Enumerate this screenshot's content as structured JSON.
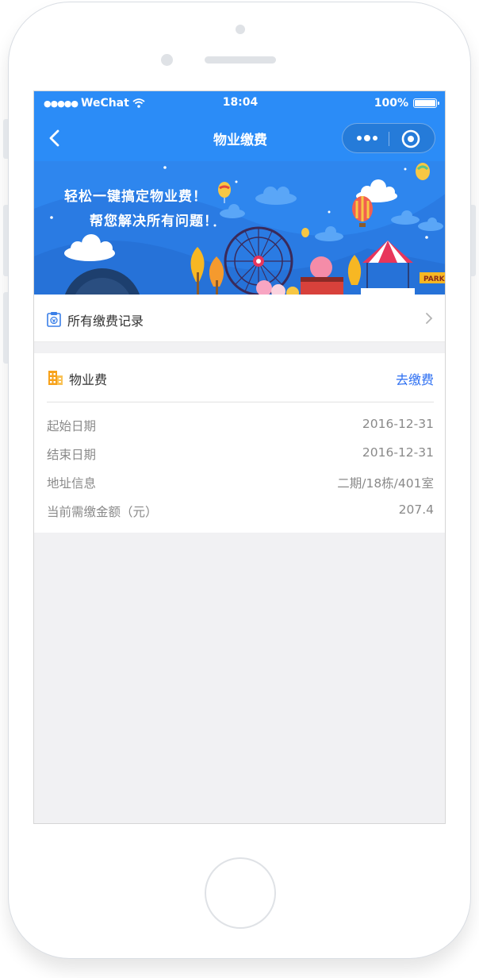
{
  "status_bar": {
    "signal_dots": "●●●●●",
    "carrier": "WeChat",
    "time": "18:04",
    "battery_percent": "100%",
    "battery_level": 1.0
  },
  "nav": {
    "title": "物业缴费"
  },
  "banner": {
    "line1": "轻松一键搞定物业费！",
    "line2": "帮您解决所有问题！",
    "sign_text": "PARK"
  },
  "records": {
    "label": "所有缴费记录"
  },
  "fee": {
    "title": "物业费",
    "action_label": "去缴费",
    "rows": [
      {
        "label": "起始日期",
        "value": "2016-12-31"
      },
      {
        "label": "结束日期",
        "value": "2016-12-31"
      },
      {
        "label": "地址信息",
        "value": "二期/18栋/401室"
      },
      {
        "label": "当前需缴金额（元）",
        "value": "207.4"
      }
    ]
  },
  "colors": {
    "brand_blue": "#2b8cf7",
    "link_blue": "#2b6ef2",
    "page_bg": "#f1f1f3"
  }
}
